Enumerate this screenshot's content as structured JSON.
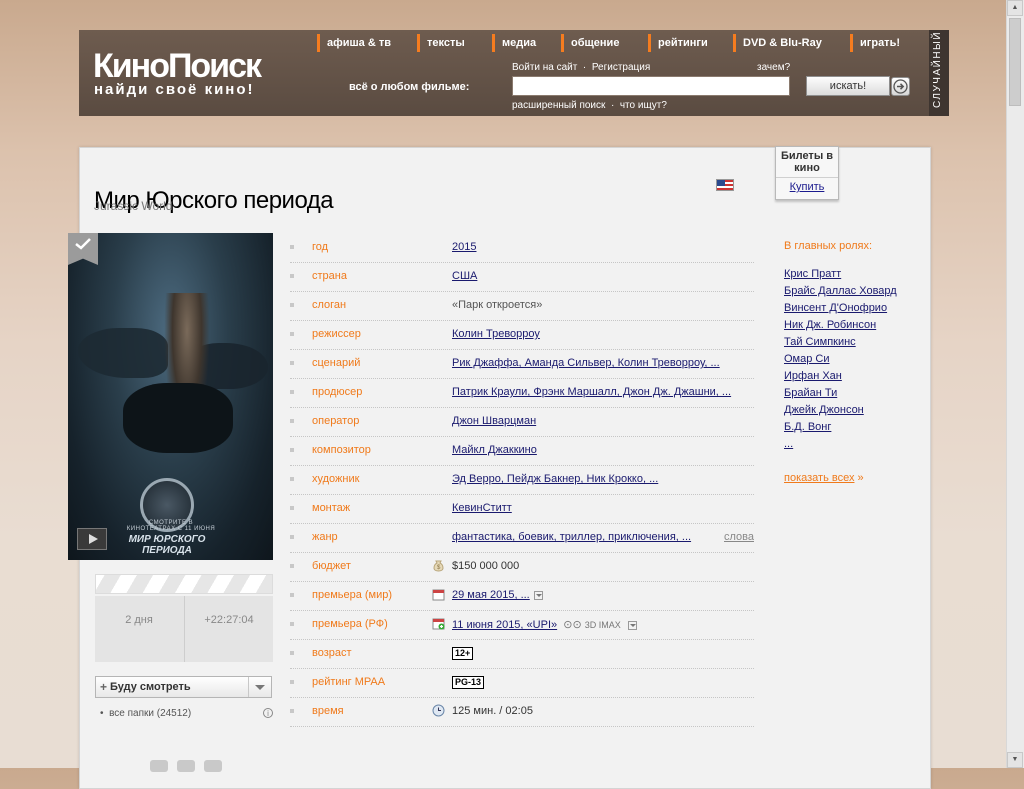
{
  "header": {
    "logo_title": "КиноПоиск",
    "logo_tagline": "найди своё кино!",
    "nav": [
      "афиша & тв",
      "тексты",
      "медиа",
      "общение",
      "рейтинги",
      "DVD & Blu-Ray",
      "играть!"
    ],
    "search_label": "всё о любом фильме:",
    "login_link": "Войти на сайт",
    "register_link": "Регистрация",
    "why_link": "зачем?",
    "search_placeholder": "",
    "search_button": "искать!",
    "advanced_search": "расширенный поиск",
    "what_searched": "что ищут?",
    "random_label": "СЛУЧАЙНЫЙ"
  },
  "film": {
    "title": "Мир Юрского периода",
    "original_title": "Jurassic World",
    "poster_title": "МИР ЮРСКОГО ПЕРИОДА",
    "poster_caption": "СМОТРИТЕ В КИНОТЕАТРАХ С 11 ИЮНЯ"
  },
  "tickets": {
    "title": "Билеты в кино",
    "buy": "Купить"
  },
  "countdown": {
    "days": "2 дня",
    "time": "+22:27:04"
  },
  "will_watch": {
    "label": "Буду смотреть",
    "folders": "все папки (24512)"
  },
  "info_rows": [
    {
      "label": "год",
      "value": "2015",
      "link": true
    },
    {
      "label": "страна",
      "value": "США",
      "link": true
    },
    {
      "label": "слоган",
      "value": "«Парк откроется»",
      "link": false
    },
    {
      "label": "режиссер",
      "value": "Колин Треворроу",
      "link": true
    },
    {
      "label": "сценарий",
      "value": "Рик Джаффа, Аманда Сильвер, Колин Треворроу, ...",
      "link": true
    },
    {
      "label": "продюсер",
      "value": "Патрик Краули, Фрэнк Маршалл, Джон Дж. Джашни, ...",
      "link": true
    },
    {
      "label": "оператор",
      "value": "Джон Шварцман",
      "link": true
    },
    {
      "label": "композитор",
      "value": "Майкл Джаккино",
      "link": true
    },
    {
      "label": "художник",
      "value": "Эд Верро, Пейдж Бакнер, Ник Крокко, ...",
      "link": true
    },
    {
      "label": "монтаж",
      "value": "КевинСтитт",
      "link": true
    },
    {
      "label": "жанр",
      "value": "фантастика, боевик, триллер, приключения, ...",
      "link": true,
      "extra": "слова"
    },
    {
      "label": "бюджет",
      "value": "$150 000 000",
      "link": false
    },
    {
      "label": "премьера (мир)",
      "value": "29 мая 2015, ...",
      "link": true
    },
    {
      "label": "премьера (РФ)",
      "value": "11 июня 2015, «UPI»",
      "link": true,
      "formats": "3D IMAX"
    },
    {
      "label": "возраст",
      "value": "12+",
      "link": false
    },
    {
      "label": "рейтинг MPAA",
      "value": "PG-13",
      "link": false
    },
    {
      "label": "время",
      "value": "125 мин. / 02:05",
      "link": false
    }
  ],
  "cast": {
    "heading": "В главных ролях:",
    "actors": [
      "Крис Пратт",
      "Брайс Даллас Ховард",
      "Винсент Д'Онофрио",
      "Ник Дж. Робинсон",
      "Тай Симпкинс",
      "Омар Си",
      "Ирфан Хан",
      "Брайан Ти",
      "Джейк Джонсон",
      "Б.Д. Вонг",
      "..."
    ],
    "show_all": "показать всех"
  },
  "colors": {
    "accent": "#f07a1b",
    "link": "#1a1a6e",
    "header_bg": "#5e4e43"
  }
}
